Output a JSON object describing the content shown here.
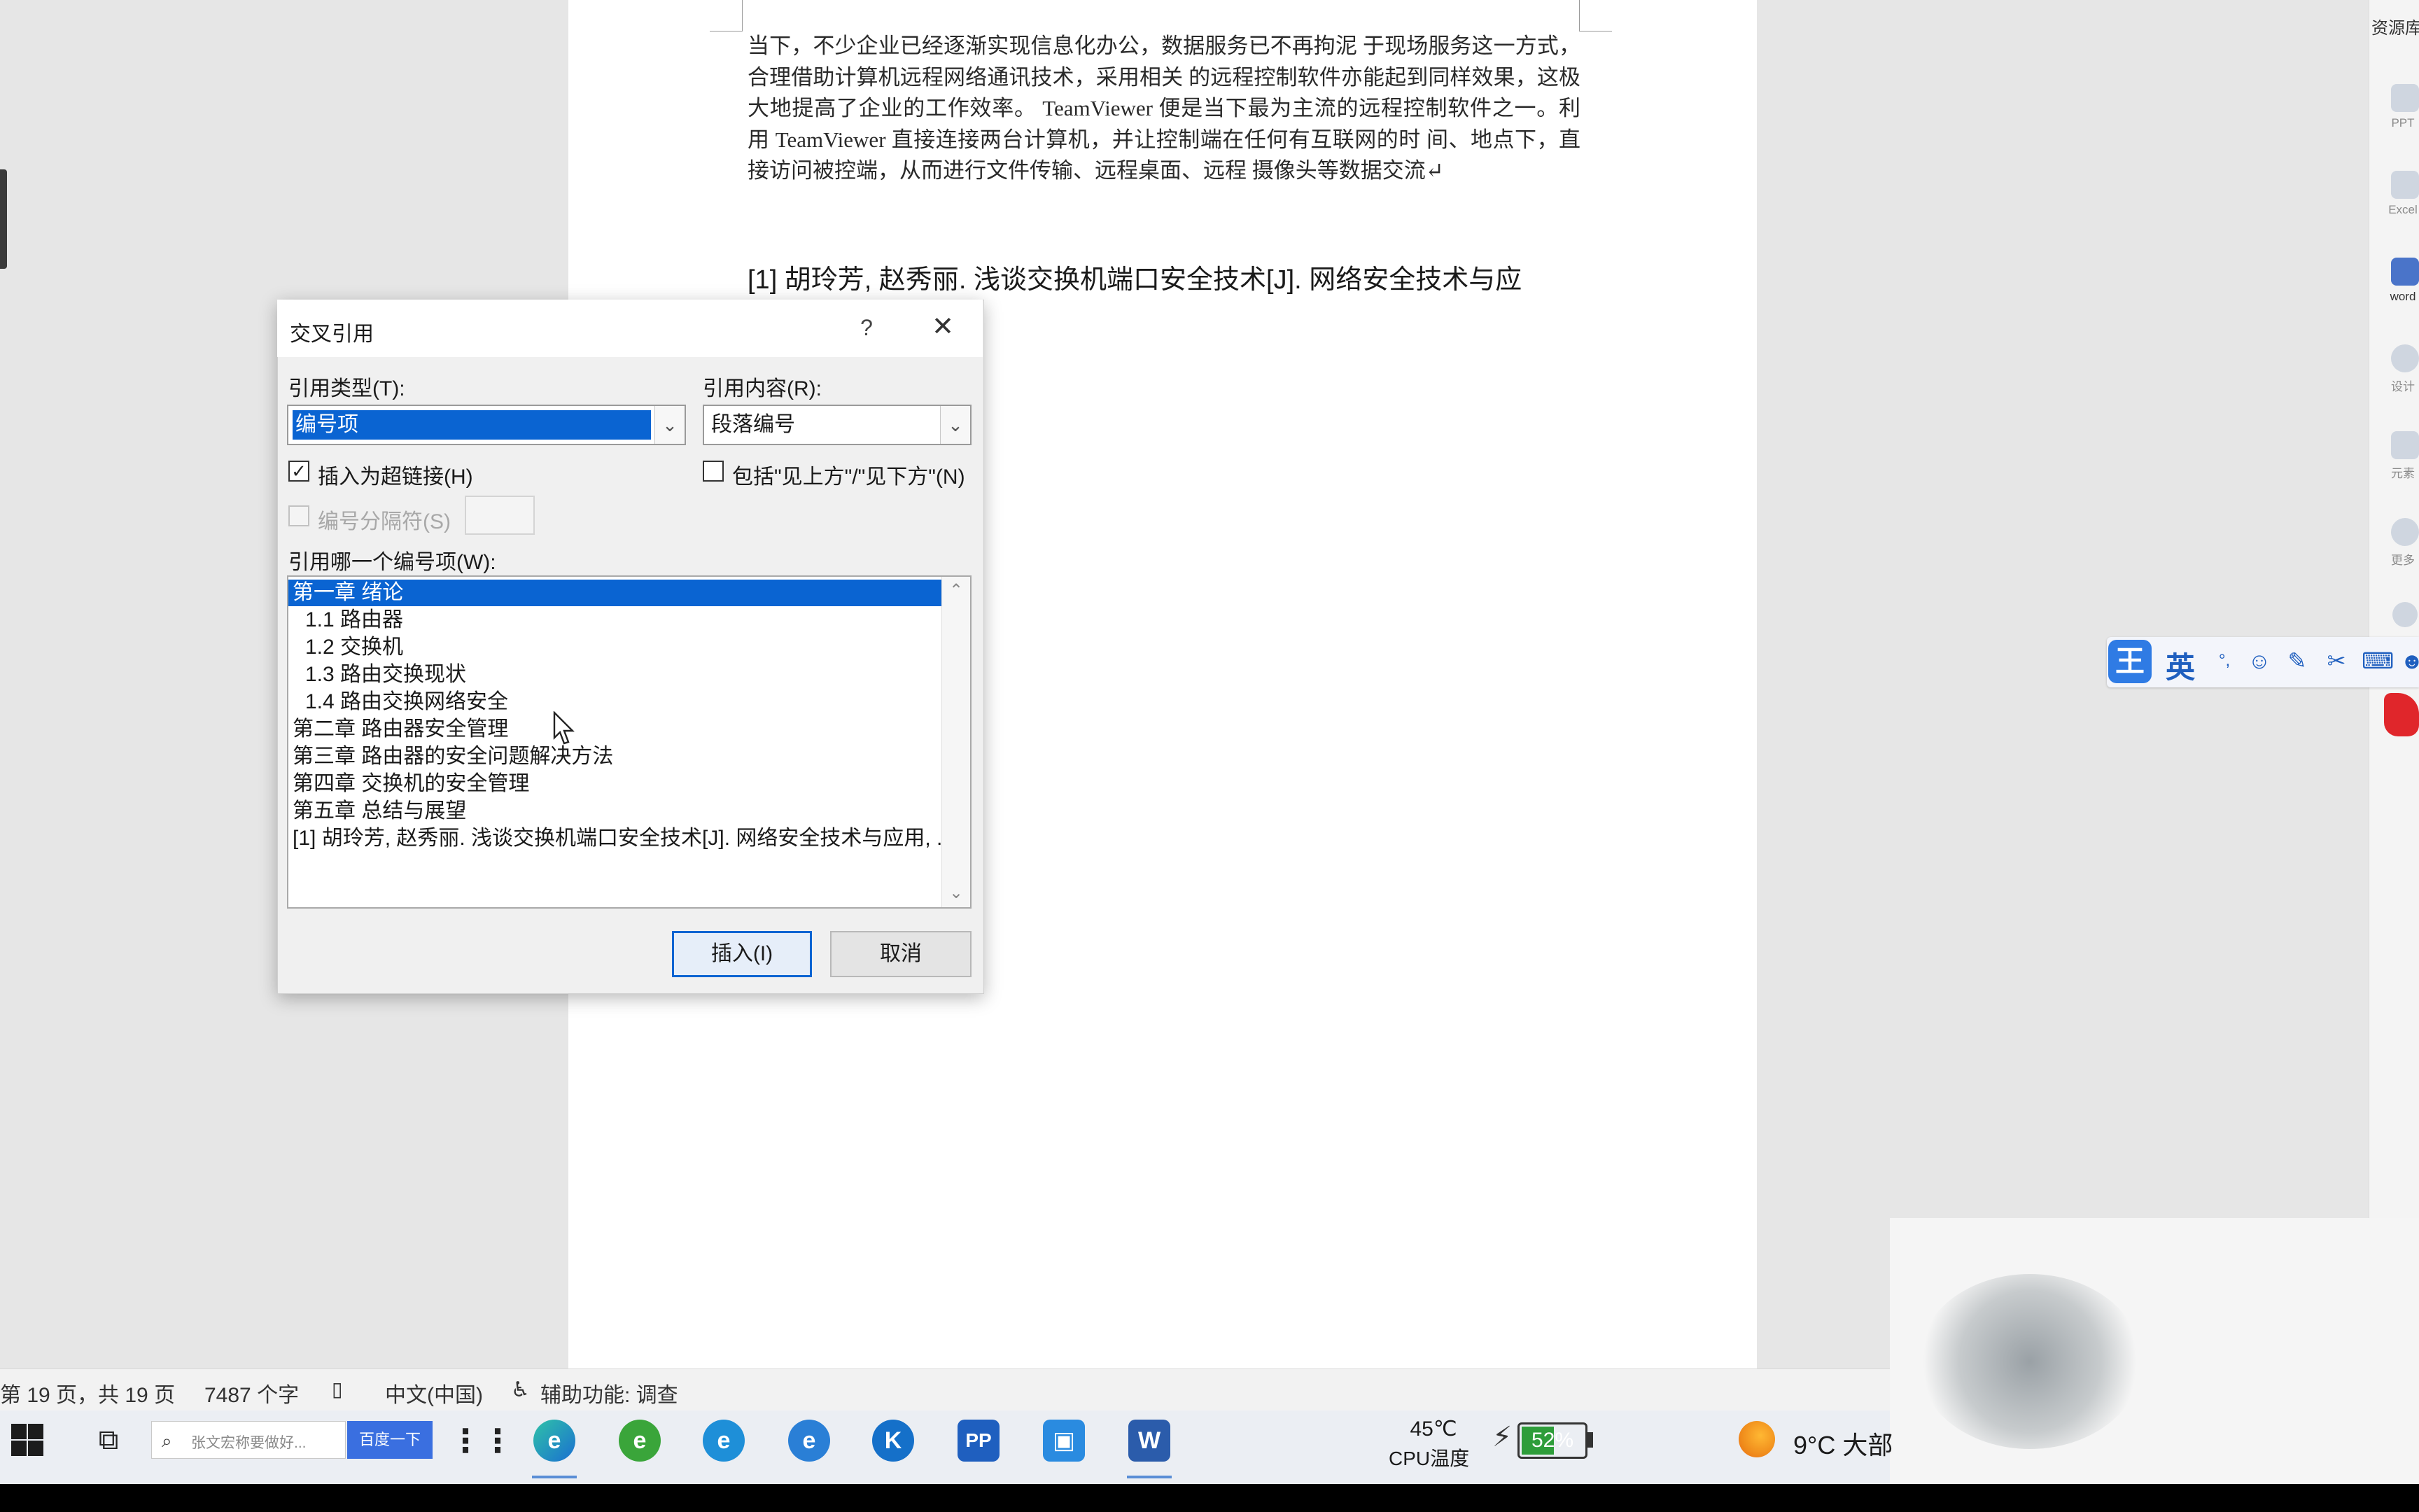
{
  "document": {
    "paragraph": "当下，不少企业已经逐渐实现信息化办公，数据服务已不再拘泥 于现场服务这一方式，合理借助计算机远程网络通讯技术，采用相关 的远程控制软件亦能起到同样效果，这极大地提高了企业的工作效率。 TeamViewer 便是当下最为主流的远程控制软件之一。利用 TeamViewer 直接连接两台计算机，并让控制端在任何有互联网的时 间、地点下，直接访问被控端，从而进行文件传输、远程桌面、远程 摄像头等数据交流↵",
    "reference_heading": "[1] 胡玲芳, 赵秀丽. 浅谈交换机端口安全技术[J]. 网络安全技术与应"
  },
  "dialog": {
    "title": "交叉引用",
    "help": "?",
    "close": "✕",
    "ref_type_label": "引用类型(T):",
    "ref_type_value": "编号项",
    "ref_content_label": "引用内容(R):",
    "ref_content_value": "段落编号",
    "insert_hyperlink_label": "插入为超链接(H)",
    "insert_hyperlink_checked": true,
    "include_above_below_label": "包括\"见上方\"/\"见下方\"(N)",
    "include_above_below_checked": false,
    "separator_label": "编号分隔符(S)",
    "which_item_label": "引用哪一个编号项(W):",
    "items": [
      {
        "text": "第一章 绪论",
        "selected": true,
        "level": 0
      },
      {
        "text": "1.1 路由器",
        "selected": false,
        "level": 1
      },
      {
        "text": "1.2 交换机",
        "selected": false,
        "level": 1
      },
      {
        "text": "1.3 路由交换现状",
        "selected": false,
        "level": 1
      },
      {
        "text": "1.4 路由交换网络安全",
        "selected": false,
        "level": 1
      },
      {
        "text": "第二章 路由器安全管理",
        "selected": false,
        "level": 0
      },
      {
        "text": "第三章 路由器的安全问题解决方法",
        "selected": false,
        "level": 0
      },
      {
        "text": "第四章 交换机的安全管理",
        "selected": false,
        "level": 0
      },
      {
        "text": "第五章 总结与展望",
        "selected": false,
        "level": 0
      },
      {
        "text": "[1] 胡玲芳, 赵秀丽. 浅谈交换机端口安全技术[J]. 网络安全技术与应用, ...",
        "selected": false,
        "level": 0
      }
    ],
    "insert_button": "插入(I)",
    "cancel_button": "取消"
  },
  "status_bar": {
    "page": "第 19 页，共 19 页",
    "word_count": "7487 个字",
    "language": "中文(中国)",
    "accessibility": "辅助功能: 调查"
  },
  "sidebar": {
    "title": "资源库",
    "items": [
      {
        "label": "PPT",
        "icon": "ppt-icon"
      },
      {
        "label": "Excel",
        "icon": "excel-icon"
      },
      {
        "label": "word",
        "icon": "word-icon"
      },
      {
        "label": "设计",
        "icon": "design-icon"
      },
      {
        "label": "元素",
        "icon": "elements-icon"
      },
      {
        "label": "更多",
        "icon": "more-icon"
      }
    ]
  },
  "ime": {
    "logo": "王",
    "lang": "英"
  },
  "taskbar": {
    "search_placeholder": "张文宏称要做好...",
    "baidu_button": "百度一下",
    "cpu_temp": "45℃",
    "cpu_label": "CPU温度",
    "battery": "52%",
    "battery_level": 0.52,
    "weather": "9°C 大部"
  },
  "colors": {
    "selection": "#0a64d2",
    "accent": "#2f7be4"
  }
}
